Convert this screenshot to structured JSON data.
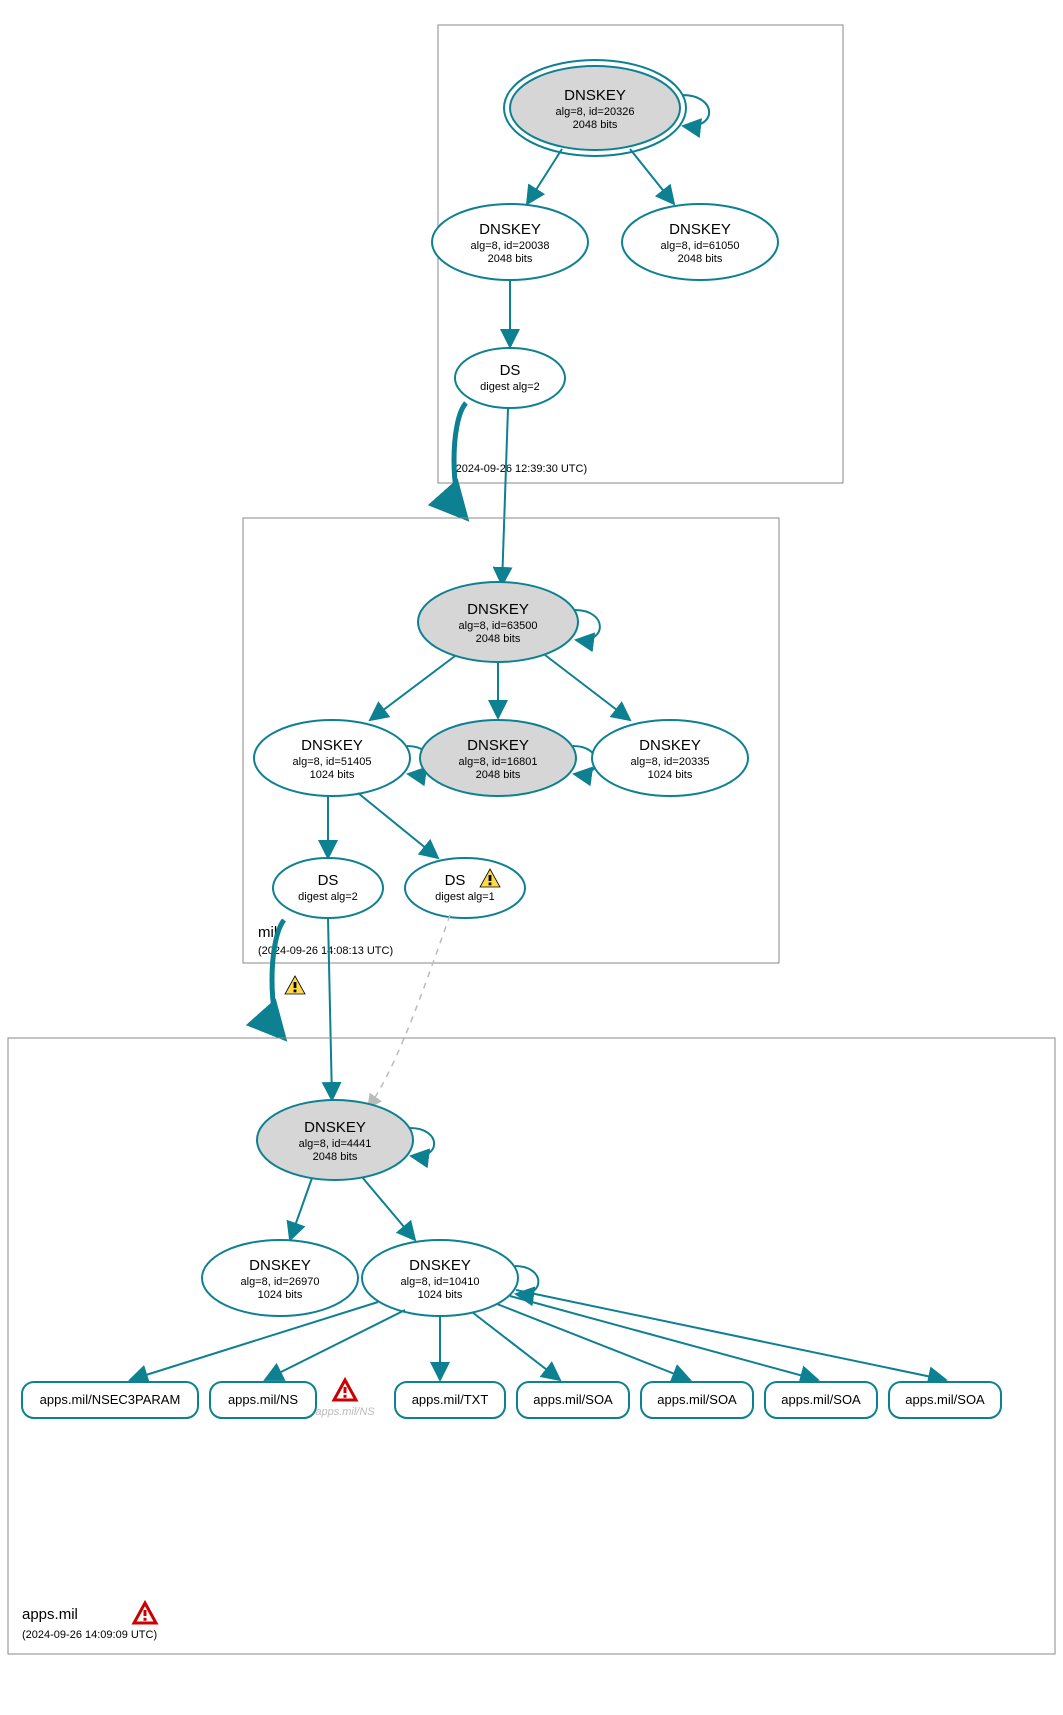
{
  "zones": {
    "root": {
      "label": ".",
      "timestamp": "(2024-09-26 12:39:30 UTC)",
      "nodes": {
        "dnskey_20326": {
          "title": "DNSKEY",
          "line1": "alg=8, id=20326",
          "line2": "2048 bits"
        },
        "dnskey_20038": {
          "title": "DNSKEY",
          "line1": "alg=8, id=20038",
          "line2": "2048 bits"
        },
        "dnskey_61050": {
          "title": "DNSKEY",
          "line1": "alg=8, id=61050",
          "line2": "2048 bits"
        },
        "ds": {
          "title": "DS",
          "line1": "digest alg=2"
        }
      }
    },
    "mil": {
      "label": "mil",
      "timestamp": "(2024-09-26 14:08:13 UTC)",
      "nodes": {
        "dnskey_63500": {
          "title": "DNSKEY",
          "line1": "alg=8, id=63500",
          "line2": "2048 bits"
        },
        "dnskey_51405": {
          "title": "DNSKEY",
          "line1": "alg=8, id=51405",
          "line2": "1024 bits"
        },
        "dnskey_16801": {
          "title": "DNSKEY",
          "line1": "alg=8, id=16801",
          "line2": "2048 bits"
        },
        "dnskey_20335": {
          "title": "DNSKEY",
          "line1": "alg=8, id=20335",
          "line2": "1024 bits"
        },
        "ds2": {
          "title": "DS",
          "line1": "digest alg=2"
        },
        "ds1": {
          "title": "DS",
          "line1": "digest alg=1"
        }
      }
    },
    "apps": {
      "label": "apps.mil",
      "timestamp": "(2024-09-26 14:09:09 UTC)",
      "nodes": {
        "dnskey_4441": {
          "title": "DNSKEY",
          "line1": "alg=8, id=4441",
          "line2": "2048 bits"
        },
        "dnskey_26970": {
          "title": "DNSKEY",
          "line1": "alg=8, id=26970",
          "line2": "1024 bits"
        },
        "dnskey_10410": {
          "title": "DNSKEY",
          "line1": "alg=8, id=10410",
          "line2": "1024 bits"
        }
      },
      "records": {
        "nsec3param": "apps.mil/NSEC3PARAM",
        "ns": "apps.mil/NS",
        "ns_ghost": "apps.mil/NS",
        "txt": "apps.mil/TXT",
        "soa1": "apps.mil/SOA",
        "soa2": "apps.mil/SOA",
        "soa3": "apps.mil/SOA"
      }
    }
  }
}
